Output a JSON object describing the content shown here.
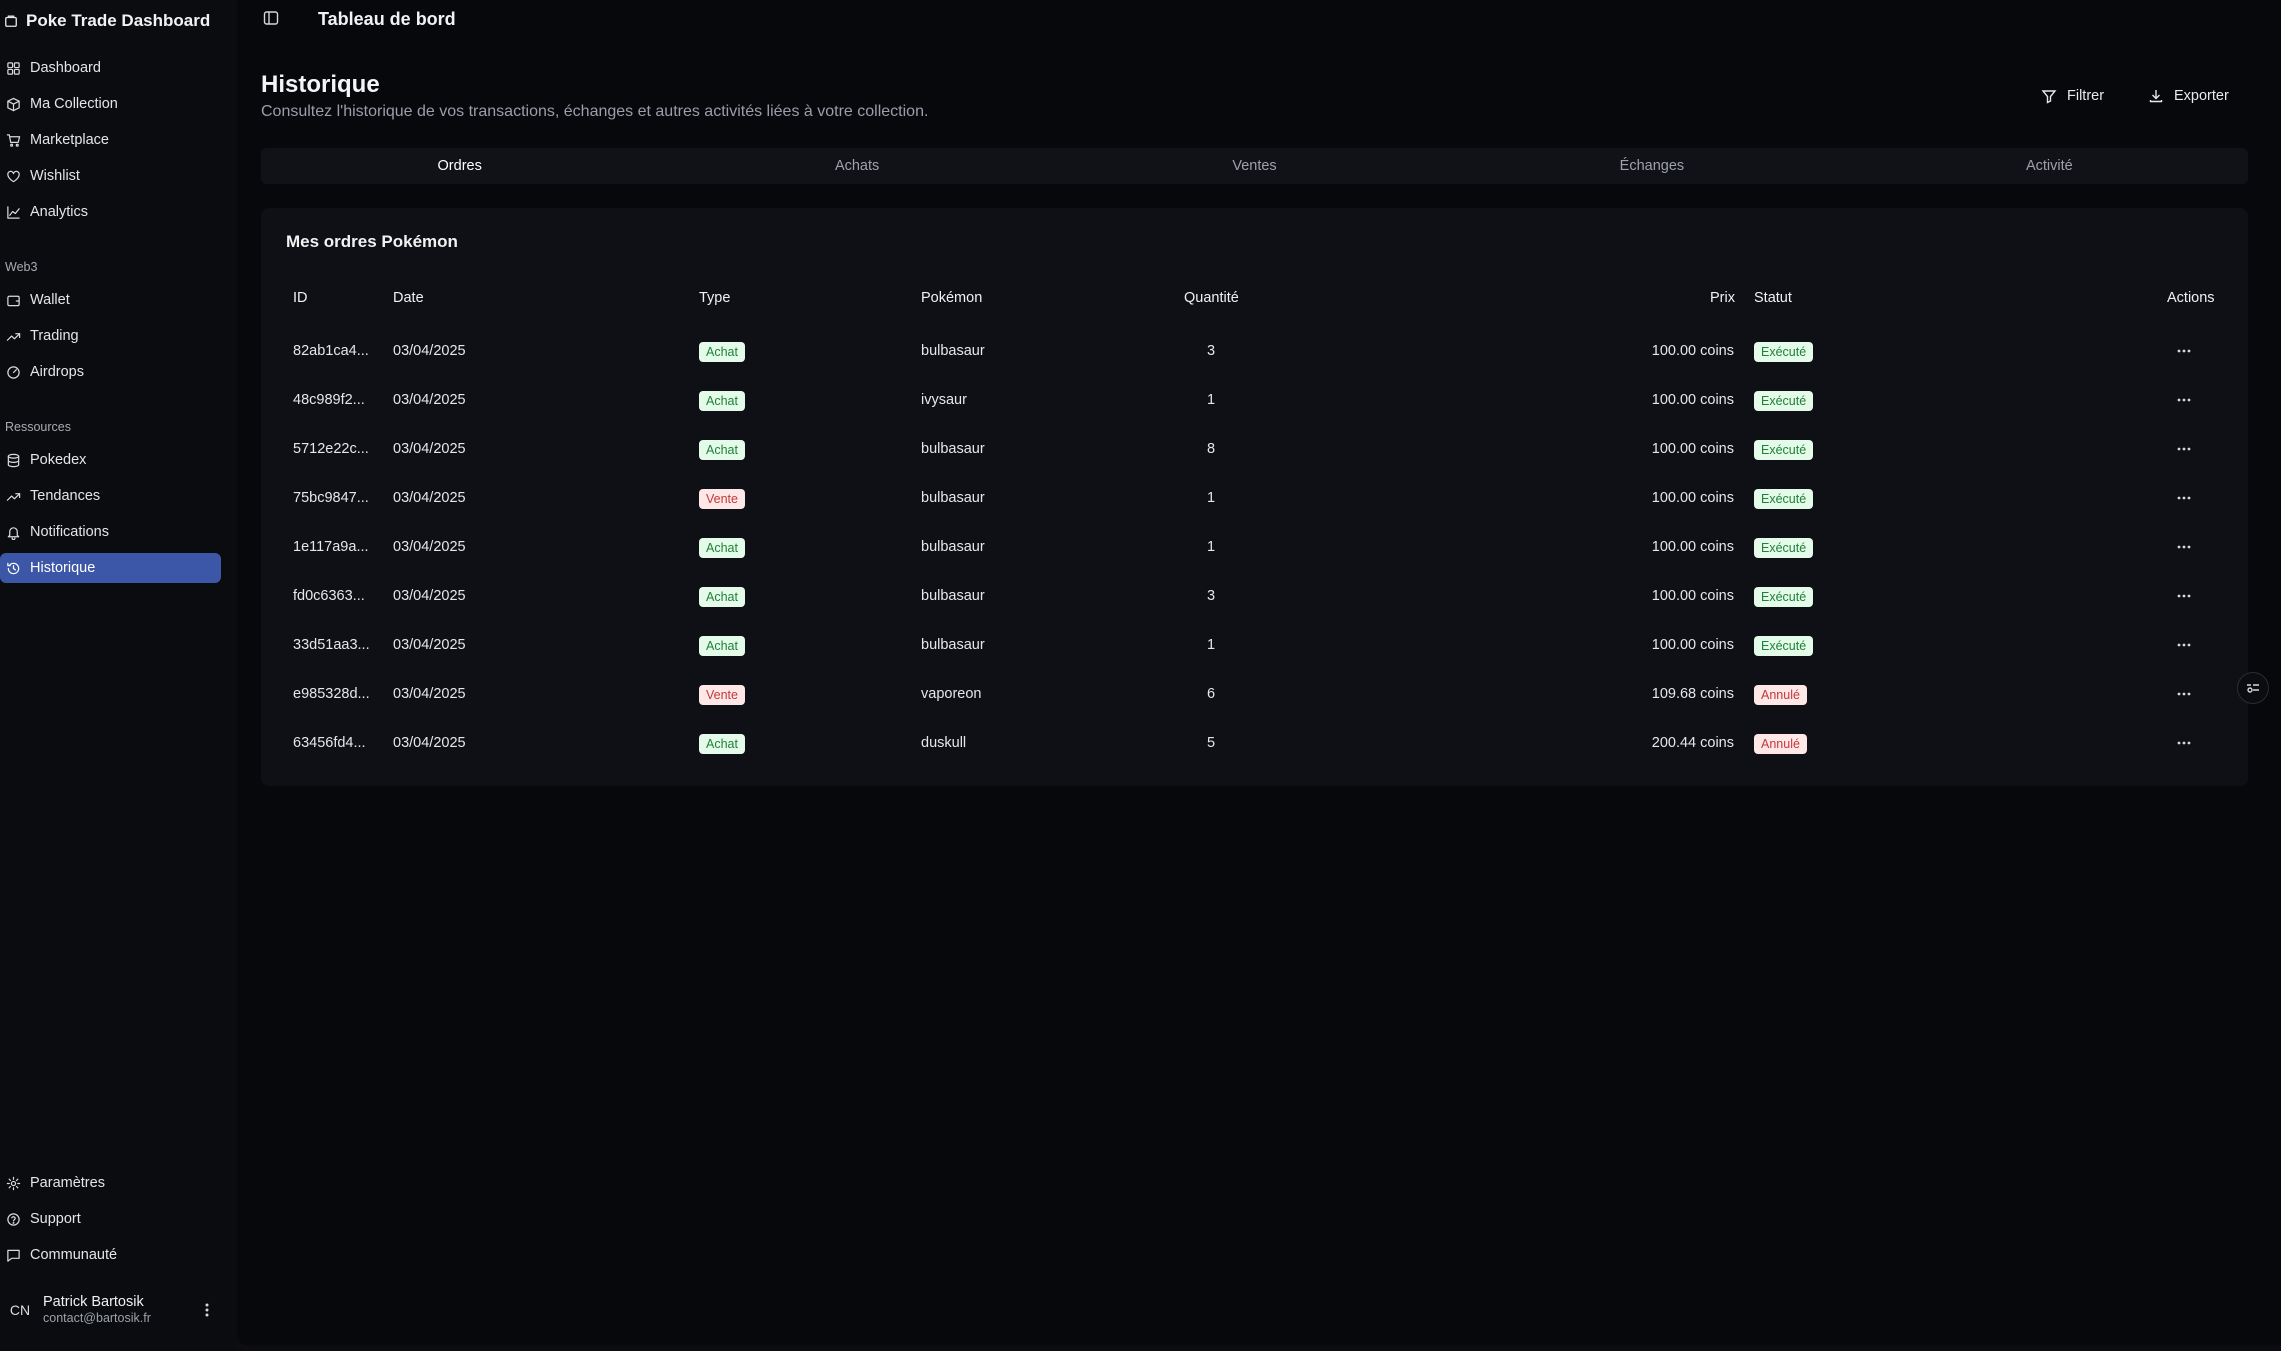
{
  "app": {
    "title": "Poke Trade Dashboard"
  },
  "sidebar": {
    "main_items": [
      {
        "label": "Dashboard",
        "icon": "dashboard-icon"
      },
      {
        "label": "Ma Collection",
        "icon": "package-icon"
      },
      {
        "label": "Marketplace",
        "icon": "cart-icon"
      },
      {
        "label": "Wishlist",
        "icon": "heart-icon"
      },
      {
        "label": "Analytics",
        "icon": "chart-line-icon"
      }
    ],
    "web3_label": "Web3",
    "web3_items": [
      {
        "label": "Wallet",
        "icon": "wallet-icon"
      },
      {
        "label": "Trading",
        "icon": "trending-up-icon"
      },
      {
        "label": "Airdrops",
        "icon": "gauge-icon"
      }
    ],
    "resources_label": "Ressources",
    "resource_items": [
      {
        "label": "Pokedex",
        "icon": "database-icon"
      },
      {
        "label": "Tendances",
        "icon": "trending-up-icon"
      },
      {
        "label": "Notifications",
        "icon": "bell-icon"
      },
      {
        "label": "Historique",
        "icon": "history-icon",
        "active": true
      }
    ],
    "bottom_items": [
      {
        "label": "Paramètres",
        "icon": "gear-icon"
      },
      {
        "label": "Support",
        "icon": "help-circle-icon"
      },
      {
        "label": "Communauté",
        "icon": "message-icon"
      }
    ],
    "user": {
      "initials": "CN",
      "name": "Patrick Bartosik",
      "email": "contact@bartosik.fr"
    }
  },
  "topbar": {
    "breadcrumb": "Tableau de bord"
  },
  "page": {
    "title": "Historique",
    "subtitle": "Consultez l'historique de vos transactions, échanges et autres activités liées à votre collection.",
    "filter_label": "Filtrer",
    "export_label": "Exporter"
  },
  "tabs": [
    {
      "label": "Ordres",
      "active": true
    },
    {
      "label": "Achats"
    },
    {
      "label": "Ventes"
    },
    {
      "label": "Échanges"
    },
    {
      "label": "Activité"
    }
  ],
  "orders": {
    "title": "Mes ordres Pokémon",
    "columns": {
      "id": "ID",
      "date": "Date",
      "type": "Type",
      "pokemon": "Pokémon",
      "quantity": "Quantité",
      "price": "Prix",
      "status": "Statut",
      "actions": "Actions"
    },
    "rows": [
      {
        "id": "82ab1ca4...",
        "date": "03/04/2025",
        "type": "Achat",
        "pokemon": "bulbasaur",
        "quantity": "3",
        "price": "100.00 coins",
        "status": "Exécuté"
      },
      {
        "id": "48c989f2...",
        "date": "03/04/2025",
        "type": "Achat",
        "pokemon": "ivysaur",
        "quantity": "1",
        "price": "100.00 coins",
        "status": "Exécuté"
      },
      {
        "id": "5712e22c...",
        "date": "03/04/2025",
        "type": "Achat",
        "pokemon": "bulbasaur",
        "quantity": "8",
        "price": "100.00 coins",
        "status": "Exécuté"
      },
      {
        "id": "75bc9847...",
        "date": "03/04/2025",
        "type": "Vente",
        "pokemon": "bulbasaur",
        "quantity": "1",
        "price": "100.00 coins",
        "status": "Exécuté"
      },
      {
        "id": "1e117a9a...",
        "date": "03/04/2025",
        "type": "Achat",
        "pokemon": "bulbasaur",
        "quantity": "1",
        "price": "100.00 coins",
        "status": "Exécuté"
      },
      {
        "id": "fd0c6363...",
        "date": "03/04/2025",
        "type": "Achat",
        "pokemon": "bulbasaur",
        "quantity": "3",
        "price": "100.00 coins",
        "status": "Exécuté"
      },
      {
        "id": "33d51aa3...",
        "date": "03/04/2025",
        "type": "Achat",
        "pokemon": "bulbasaur",
        "quantity": "1",
        "price": "100.00 coins",
        "status": "Exécuté"
      },
      {
        "id": "e985328d...",
        "date": "03/04/2025",
        "type": "Vente",
        "pokemon": "vaporeon",
        "quantity": "6",
        "price": "109.68 coins",
        "status": "Annulé"
      },
      {
        "id": "63456fd4...",
        "date": "03/04/2025",
        "type": "Achat",
        "pokemon": "duskull",
        "quantity": "5",
        "price": "200.44 coins",
        "status": "Annulé"
      }
    ]
  },
  "colors": {
    "active_nav": "#3c56a8",
    "buy_badge": "#e5fbe9",
    "sell_badge": "#fde7e7"
  }
}
